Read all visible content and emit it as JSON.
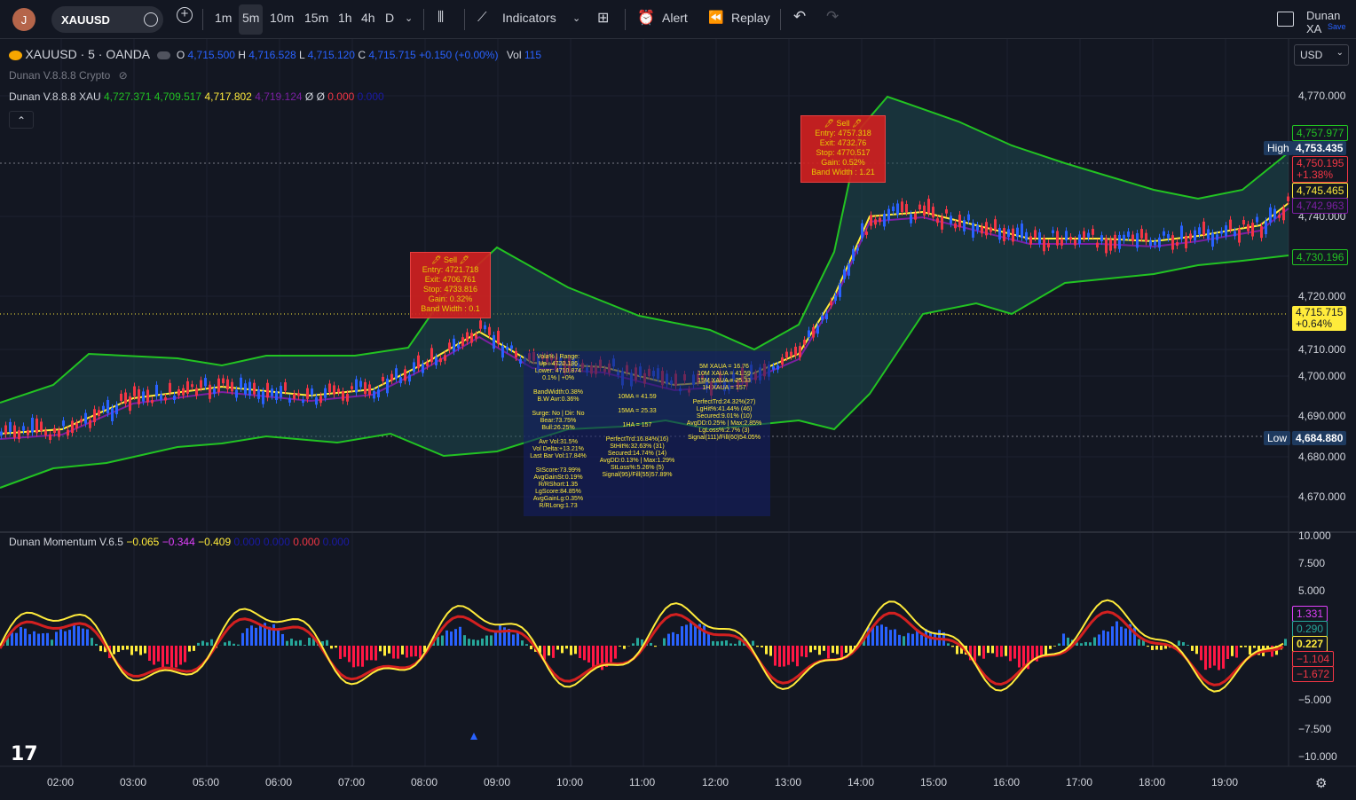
{
  "user": {
    "avatar_letter": "J",
    "name": "Dunan XA",
    "save_label": "Save"
  },
  "toolbar": {
    "symbol": "XAUUSD",
    "intervals": [
      "1m",
      "5m",
      "10m",
      "15m",
      "1h",
      "4h",
      "D"
    ],
    "active_interval": "5m",
    "indicators_label": "Indicators",
    "alert_label": "Alert",
    "replay_label": "Replay"
  },
  "currency": "USD",
  "legend": {
    "title": "XAUUSD · 5 · OANDA",
    "o_label": "O",
    "o_value": "4,715.500",
    "h_label": "H",
    "h_value": "4,716.528",
    "l_label": "L",
    "l_value": "4,715.120",
    "c_label": "C",
    "c_value": "4,715.715",
    "change": "+0.150 (+0.00%)",
    "vol_label": "Vol",
    "vol_value": "115",
    "indicator1": "Dunan V.8.8.8 Crypto",
    "indicator2_name": "Dunan V.8.8.8 XAU",
    "indicator2_values": [
      "4,727.371",
      "4,709.517",
      "4,717.802",
      "4,719.124",
      "Ø",
      "Ø",
      "0.000",
      "0.000"
    ],
    "momentum_name": "Dunan Momentum V.6.5",
    "momentum_values": [
      "−0.065",
      "−0.344",
      "−0.409",
      "0.000",
      "0.000",
      "0.000",
      "0.000"
    ]
  },
  "price_axis": [
    "4,770.000",
    "4,740.000",
    "4,720.000",
    "4,710.000",
    "4,700.000",
    "4,690.000",
    "4,680.000",
    "4,670.000"
  ],
  "price_tags": {
    "upper_band": "4,757.977",
    "high_label": "High",
    "high_value": "4,753.435",
    "red_tag": "4,750.195",
    "red_pct": "+1.38%",
    "yellow_tag": "4,745.465",
    "blue_tag": "4,742.963",
    "lower_band": "4,730.196",
    "current": "4,715.715",
    "current_pct": "+0.64%",
    "low_label": "Low",
    "low_value": "4,684.880"
  },
  "momentum_axis": [
    "10.000",
    "7.500",
    "5.000",
    "−5.000",
    "−7.500",
    "−10.000"
  ],
  "momentum_tags": [
    "1.331",
    "0.290",
    "0.227",
    "−1.104",
    "−1.672"
  ],
  "time_axis": [
    "02:00",
    "03:00",
    "05:00",
    "06:00",
    "07:00",
    "08:00",
    "09:00",
    "10:00",
    "11:00",
    "12:00",
    "13:00",
    "14:00",
    "15:00",
    "16:00",
    "17:00",
    "18:00",
    "19:00"
  ],
  "sell1": {
    "title": "🖊 Sell 🖊",
    "lines": [
      "Entry: 4721.718",
      "Exit: 4706.761",
      "Stop: 4733.816",
      "Gain: 0.32%",
      "Band Width : 0.1"
    ]
  },
  "sell2": {
    "title": "🖊 Sell 🖊",
    "lines": [
      "Entry: 4757.318",
      "Exit: 4732.76",
      "Stop: 4770.517",
      "Gain: 0.52%",
      "Band Width : 1.21"
    ]
  },
  "info_panel": {
    "col1": [
      "Vola% | Range:",
      "Up : 4720.186",
      "Lower: 4710.874",
      "0.1% | +0%",
      "",
      "BandWidth:0.38%",
      "B.W Avr:0.36%",
      "",
      "Surge: No | Dir: No",
      "Bear:73.75%",
      "Bull:26.25%",
      "",
      "Avr Vol:31.5%",
      "Vol Delta:+13.21%",
      "Last Bar Vol:17.84%",
      "",
      "StScore:73.99%",
      "AvgGainSt:0.19%",
      "R/RShort:1.35",
      "LgScore:84.85%",
      "AvgGainLg:0.35%",
      "R/RLong:1.73"
    ],
    "col2": [
      "10MA = 41.59",
      "",
      "15MA = 25.33",
      "",
      "1HA = 157",
      "",
      "PerfectTrd:16.84%(16)",
      "StHit%:32.63% (31)",
      "Secured:14.74% (14)",
      "AvgDD:0.13% | Max:1.29%",
      "StLoss%:5.26% (5)",
      "Signal(95)/Fill(55)57.89%"
    ],
    "col3": [
      "5M XAUA = 16.76",
      "10M XAUA = 41.59",
      "15M XAUA = 25.33",
      "1H XAUA = 157",
      "",
      "PerfectTrd:24.32%(27)",
      "LgHit%:41.44% (46)",
      "Secured:9.01% (10)",
      "AvgDD:0.25% | Max:2.85%",
      "LgLoss%:2.7% (3)",
      "Signal(111)/Fill(60)54.05%"
    ]
  },
  "colors": {
    "bg": "#131722",
    "up": "#2962ff",
    "down": "#f23645",
    "band": "#22c322",
    "yellow": "#ffeb3b",
    "purple": "#7b1fa2",
    "teal_fill": "#1e4a50"
  }
}
